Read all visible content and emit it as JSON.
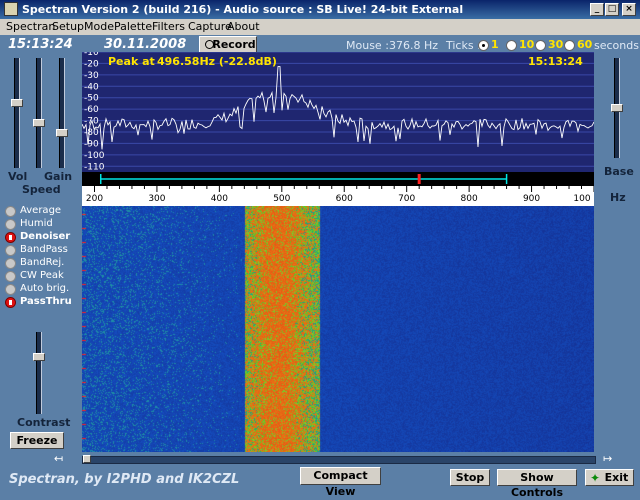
{
  "window": {
    "title": "Spectran Version 2 (build 216) - Audio source :  SB Live! 24-bit External",
    "controls": {
      "minimize": "_",
      "maximize": "□",
      "close": "×"
    }
  },
  "menu": [
    "Spectran",
    "Setup",
    "Mode",
    "Palette",
    "Filters",
    "Capture",
    "About"
  ],
  "clock": {
    "time": "15:13:24",
    "date": "30.11.2008"
  },
  "record_label": "Record",
  "mouse": {
    "label": "Mouse :",
    "value": "376.8 Hz"
  },
  "ticks": {
    "label": "Ticks :",
    "options": [
      "1",
      "10",
      "30",
      "60"
    ],
    "selected": "1",
    "unit": "seconds"
  },
  "spectrum": {
    "peak_label": "Peak at",
    "peak_value": "496.58Hz (-22.8dB)",
    "time": "15:13:24",
    "db_ticks": [
      "-10",
      "-20",
      "-30",
      "-40",
      "-50",
      "-60",
      "-70",
      "-80",
      "-90",
      "-100",
      "-110"
    ],
    "freq_ticks": [
      "200",
      "300",
      "400",
      "500",
      "600",
      "700",
      "800",
      "900",
      "100"
    ],
    "freq_range_hz": [
      180,
      1000
    ],
    "db_range": [
      -115,
      -10
    ],
    "peak": {
      "freq_hz": 496.58,
      "db": -22.8
    },
    "filter_band_hz": [
      210,
      860
    ],
    "filter_marker_hz": 720
  },
  "labels": {
    "vol": "Vol",
    "gain": "Gain",
    "speed": "Speed",
    "contrast": "Contrast",
    "base": "Base",
    "hz": "Hz"
  },
  "levels": {
    "vol": 0.6,
    "gain": 0.4,
    "speed": 0.3,
    "contrast": 0.72,
    "base": 0.5
  },
  "filters": [
    {
      "label": "Average",
      "on": false
    },
    {
      "label": "Humid",
      "on": false
    },
    {
      "label": "Denoiser",
      "on": true
    },
    {
      "label": "BandPass",
      "on": false
    },
    {
      "label": "BandRej.",
      "on": false
    },
    {
      "label": "CW Peak",
      "on": false
    },
    {
      "label": "Auto brig.",
      "on": false
    },
    {
      "label": "PassThru",
      "on": true
    }
  ],
  "buttons": {
    "freeze": "Freeze",
    "compact_view": "Compact View",
    "stop": "Stop",
    "show_controls": "Show Controls",
    "exit": "Exit"
  },
  "credit": "Spectran, by I2PHD and IK2CZL",
  "colors": {
    "background": "#5b7fa6",
    "spectrum_bg": "#1f2670",
    "waterfall_bg": "#1b3ea8",
    "peak_text": "#ffe400",
    "filter_band": "#00e5e5",
    "filter_marker": "#ff2020"
  }
}
